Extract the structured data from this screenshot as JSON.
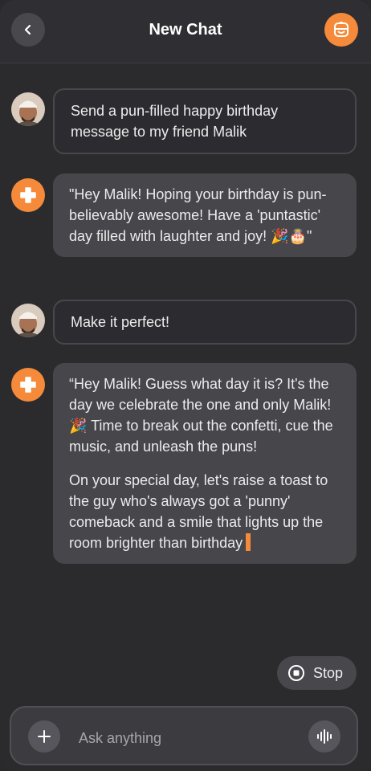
{
  "header": {
    "title": "New Chat",
    "back_icon": "chevron-left-icon",
    "bot_icon": "bot-icon"
  },
  "messages": [
    {
      "role": "user",
      "paragraphs": [
        "Send a pun-filled happy birthday message to my friend Malik"
      ]
    },
    {
      "role": "assistant",
      "paragraphs": [
        "\"Hey Malik! Hoping your birthday is pun-believably awesome! Have a 'puntastic' day filled with laughter and joy! 🎉🎂\""
      ]
    },
    {
      "role": "user",
      "paragraphs": [
        "Make it perfect!"
      ]
    },
    {
      "role": "assistant",
      "streaming": true,
      "paragraphs": [
        "“Hey Malik! Guess what day it is? It's the day we celebrate the one and only Malik! 🎉 Time to break out the confetti, cue the music, and unleash the puns!",
        "On your special day, let's raise a toast to the guy who's always got a 'punny' comeback and a smile that lights up the room brighter than birthday"
      ]
    }
  ],
  "stop_button": {
    "label": "Stop",
    "icon": "stop-icon"
  },
  "composer": {
    "placeholder": "Ask anything",
    "value": "",
    "add_icon": "plus-icon",
    "voice_icon": "waveform-icon"
  },
  "colors": {
    "accent": "#f58a3a",
    "background": "#2b2b2e",
    "assistant_bubble": "#46464b",
    "user_bubble_border": "#47474c"
  }
}
